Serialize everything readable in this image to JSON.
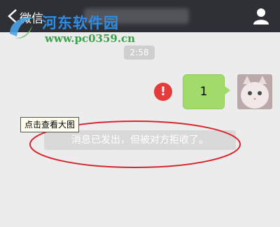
{
  "header": {
    "back_label": "微信",
    "icons": {
      "back": "chevron-left-icon",
      "profile": "person-icon"
    }
  },
  "watermark": {
    "title": "河东软件园",
    "url": "www.pc0359.cn"
  },
  "chat": {
    "timestamp": "2:58",
    "messages": [
      {
        "sender": "me",
        "text": "1",
        "status": "send-failed",
        "status_icon": "!"
      }
    ],
    "system_notice": "消息已发出，但被对方拒收了。",
    "tooltip": "点击查看大图"
  },
  "colors": {
    "header_bg": "#2e3035",
    "chat_bg": "#ececec",
    "bubble_green": "#a1dc6a",
    "error_red": "#e43b3b",
    "annotation_red": "#d8262e"
  }
}
